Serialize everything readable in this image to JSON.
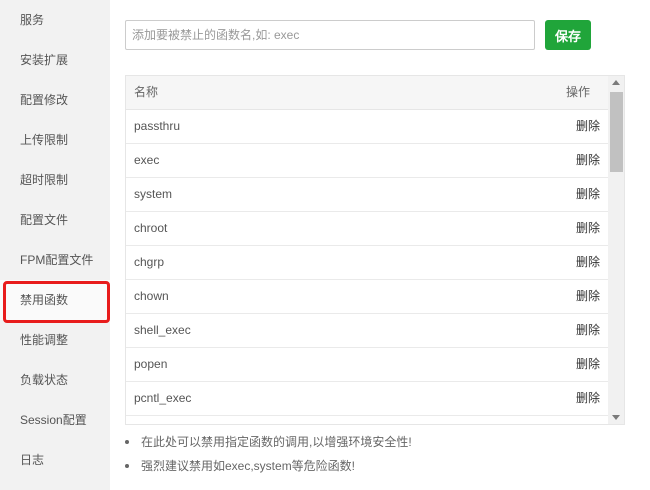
{
  "sidebar": {
    "items": [
      {
        "label": "服务"
      },
      {
        "label": "安装扩展"
      },
      {
        "label": "配置修改"
      },
      {
        "label": "上传限制"
      },
      {
        "label": "超时限制"
      },
      {
        "label": "配置文件"
      },
      {
        "label": "FPM配置文件"
      },
      {
        "label": "禁用函数"
      },
      {
        "label": "性能调整"
      },
      {
        "label": "负载状态"
      },
      {
        "label": "Session配置"
      },
      {
        "label": "日志"
      }
    ],
    "selected": "禁用函数",
    "highlight_color": "#e81c1c"
  },
  "form": {
    "placeholder": "添加要被禁止的函数名,如: exec",
    "value": "",
    "save_label": "保存",
    "save_color": "#20a53a"
  },
  "table": {
    "headers": {
      "name": "名称",
      "op": "操作"
    },
    "rows": [
      {
        "name": "passthru",
        "op": "删除"
      },
      {
        "name": "exec",
        "op": "删除"
      },
      {
        "name": "system",
        "op": "删除"
      },
      {
        "name": "chroot",
        "op": "删除"
      },
      {
        "name": "chgrp",
        "op": "删除"
      },
      {
        "name": "chown",
        "op": "删除"
      },
      {
        "name": "shell_exec",
        "op": "删除"
      },
      {
        "name": "popen",
        "op": "删除"
      },
      {
        "name": "pcntl_exec",
        "op": "删除"
      },
      {
        "name": "",
        "op": ""
      }
    ]
  },
  "notes": [
    "在此处可以禁用指定函数的调用,以增强环境安全性!",
    "强烈建议禁用如exec,system等危险函数!"
  ]
}
